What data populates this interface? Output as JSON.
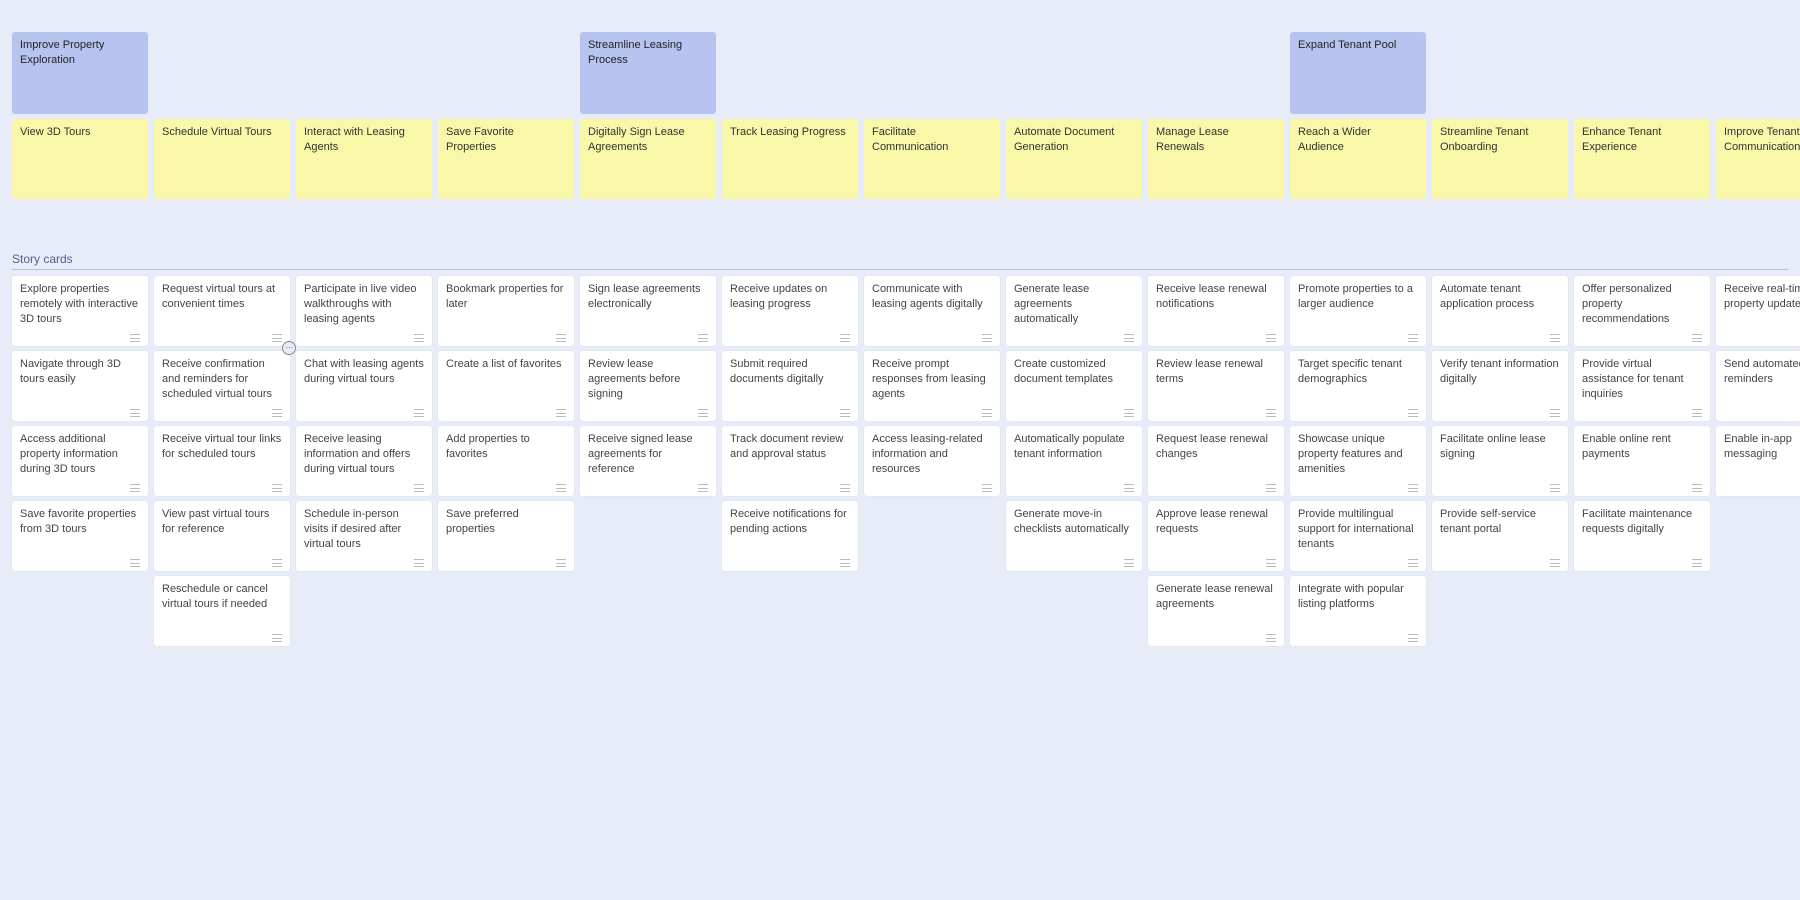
{
  "section_label": "Story cards",
  "epics": [
    {
      "at": 0,
      "label": "Improve Property Exploration"
    },
    {
      "at": 4,
      "label": "Streamline Leasing Process"
    },
    {
      "at": 9,
      "label": "Expand Tenant Pool"
    }
  ],
  "columns": [
    {
      "activity": "View 3D Tours",
      "stories": [
        "Explore properties remotely with interactive 3D tours",
        "Navigate through 3D tours easily",
        "Access additional property information during 3D tours",
        "Save favorite properties from 3D tours"
      ]
    },
    {
      "activity": "Schedule Virtual Tours",
      "hover_index": 1,
      "stories": [
        "Request virtual tours at convenient times",
        "Receive confirmation and reminders for scheduled virtual tours",
        "Receive virtual tour links for scheduled tours",
        "View past virtual tours for reference",
        "Reschedule or cancel virtual tours if needed"
      ]
    },
    {
      "activity": "Interact with Leasing Agents",
      "stories": [
        "Participate in live video walkthroughs with leasing agents",
        "Chat with leasing agents during virtual tours",
        "Receive leasing information and offers during virtual tours",
        "Schedule in-person visits if desired after virtual tours"
      ]
    },
    {
      "activity": "Save Favorite Properties",
      "stories": [
        "Bookmark properties for later",
        "Create a list of favorites",
        "Add properties to favorites",
        "Save preferred properties"
      ]
    },
    {
      "activity": "Digitally Sign Lease Agreements",
      "stories": [
        "Sign lease agreements electronically",
        "Review lease agreements before signing",
        "Receive signed lease agreements for reference"
      ]
    },
    {
      "activity": "Track Leasing Progress",
      "stories": [
        "Receive updates on leasing progress",
        "Submit required documents digitally",
        "Track document review and approval status",
        "Receive notifications for pending actions"
      ]
    },
    {
      "activity": "Facilitate Communication",
      "stories": [
        "Communicate with leasing agents digitally",
        "Receive prompt responses from leasing agents",
        "Access leasing-related information and resources"
      ]
    },
    {
      "activity": "Automate Document Generation",
      "stories": [
        "Generate lease agreements automatically",
        "Create customized document templates",
        "Automatically populate tenant information",
        "Generate move-in checklists automatically"
      ]
    },
    {
      "activity": "Manage Lease Renewals",
      "stories": [
        "Receive lease renewal notifications",
        "Review lease renewal terms",
        "Request lease renewal changes",
        "Approve lease renewal requests",
        "Generate lease renewal agreements"
      ]
    },
    {
      "activity": "Reach a Wider Audience",
      "stories": [
        "Promote properties to a larger audience",
        "Target specific tenant demographics",
        "Showcase unique property features and amenities",
        "Provide multilingual support for international tenants",
        "Integrate with popular listing platforms"
      ]
    },
    {
      "activity": "Streamline Tenant Onboarding",
      "stories": [
        "Automate tenant application process",
        "Verify tenant information digitally",
        "Facilitate online lease signing",
        "Provide self-service tenant portal"
      ]
    },
    {
      "activity": "Enhance Tenant Experience",
      "stories": [
        "Offer personalized property recommendations",
        "Provide virtual assistance for tenant inquiries",
        "Enable online rent payments",
        "Facilitate maintenance requests digitally"
      ]
    },
    {
      "activity": "Improve Tenant Communication",
      "stories": [
        "Receive real-time property updates",
        "Send automated lease reminders",
        "Enable in-app messaging"
      ]
    }
  ]
}
